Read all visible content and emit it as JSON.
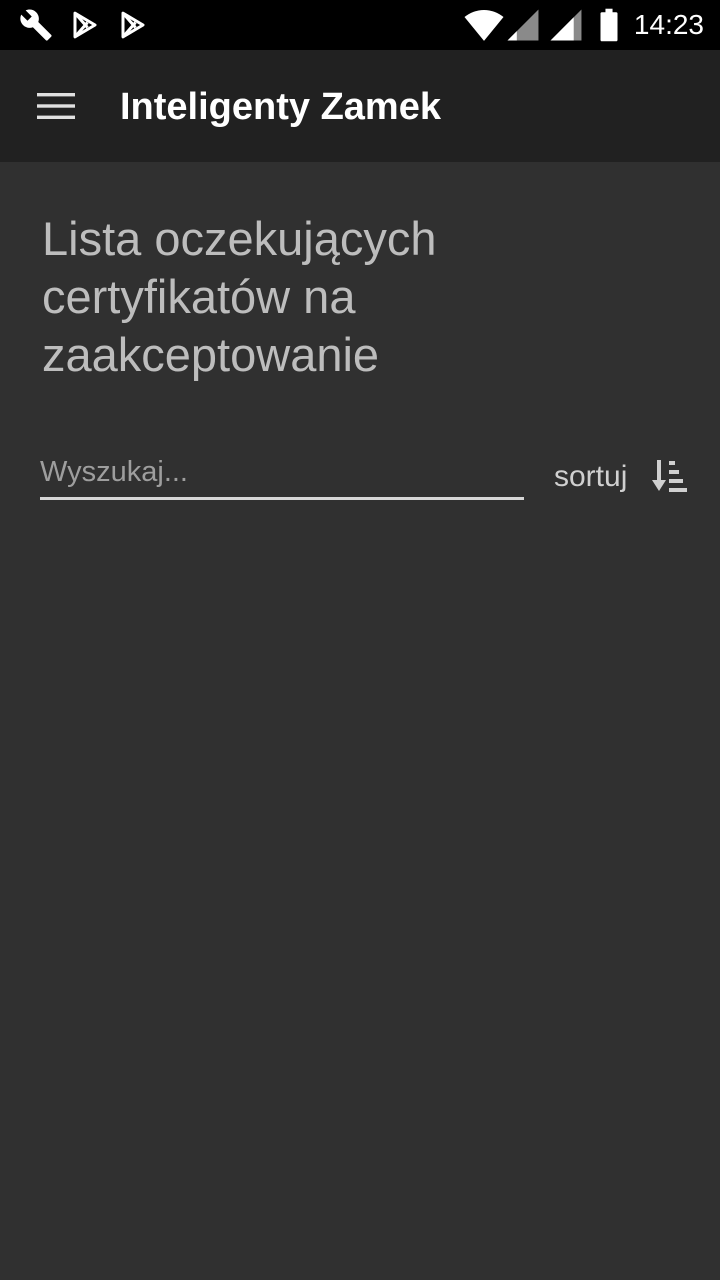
{
  "status_bar": {
    "time": "14:23",
    "icons": [
      "wrench-icon",
      "play-store-icon",
      "play-store-icon",
      "wifi-icon",
      "signal-icon",
      "signal-icon",
      "battery-icon"
    ]
  },
  "app_bar": {
    "title": "Inteligenty Zamek",
    "menu_icon": "hamburger-menu-icon"
  },
  "page": {
    "heading": "Lista oczekujących certyfikatów na zaakceptowanie",
    "search": {
      "placeholder": "Wyszukaj...",
      "value": ""
    },
    "sort": {
      "label": "sortuj",
      "icon": "sort-icon"
    }
  },
  "colors": {
    "background": "#303030",
    "app_bar": "#212121",
    "status_bar": "#000000",
    "text_primary": "#ffffff",
    "text_secondary": "#bdbdbd"
  }
}
